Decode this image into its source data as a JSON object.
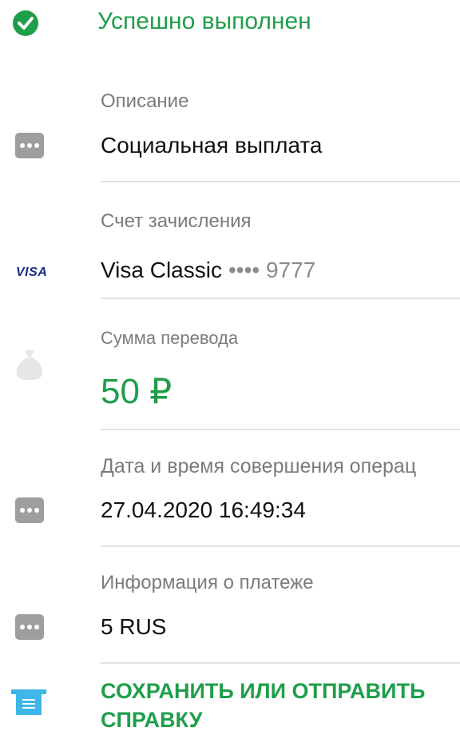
{
  "status": {
    "text": "Успешно выполнен",
    "icon": "check-circle-icon"
  },
  "fields": [
    {
      "label": "Описание",
      "value": "Социальная выплата",
      "icon": "more-dots-icon"
    },
    {
      "label": "Счет зачисления",
      "card_name": "Visa Classic",
      "card_masked": "•••• 9777",
      "icon_text": "VISA"
    },
    {
      "label": "Сумма перевода",
      "value": "50 ₽",
      "icon": "money-bag-icon"
    },
    {
      "label": "Дата и время совершения операц",
      "value": "27.04.2020 16:49:34",
      "icon": "more-dots-icon"
    },
    {
      "label": "Информация о платеже",
      "value": "5 RUS",
      "icon": "more-dots-icon"
    }
  ],
  "action": {
    "label": "СОХРАНИТЬ ИЛИ ОТПРАВИТЬ СПРАВКУ",
    "icon": "receipt-icon"
  },
  "colors": {
    "accent": "#1f9e4a",
    "label": "#7b7b7b",
    "icon_gray": "#9e9e9e",
    "receipt": "#3fb6e8"
  }
}
